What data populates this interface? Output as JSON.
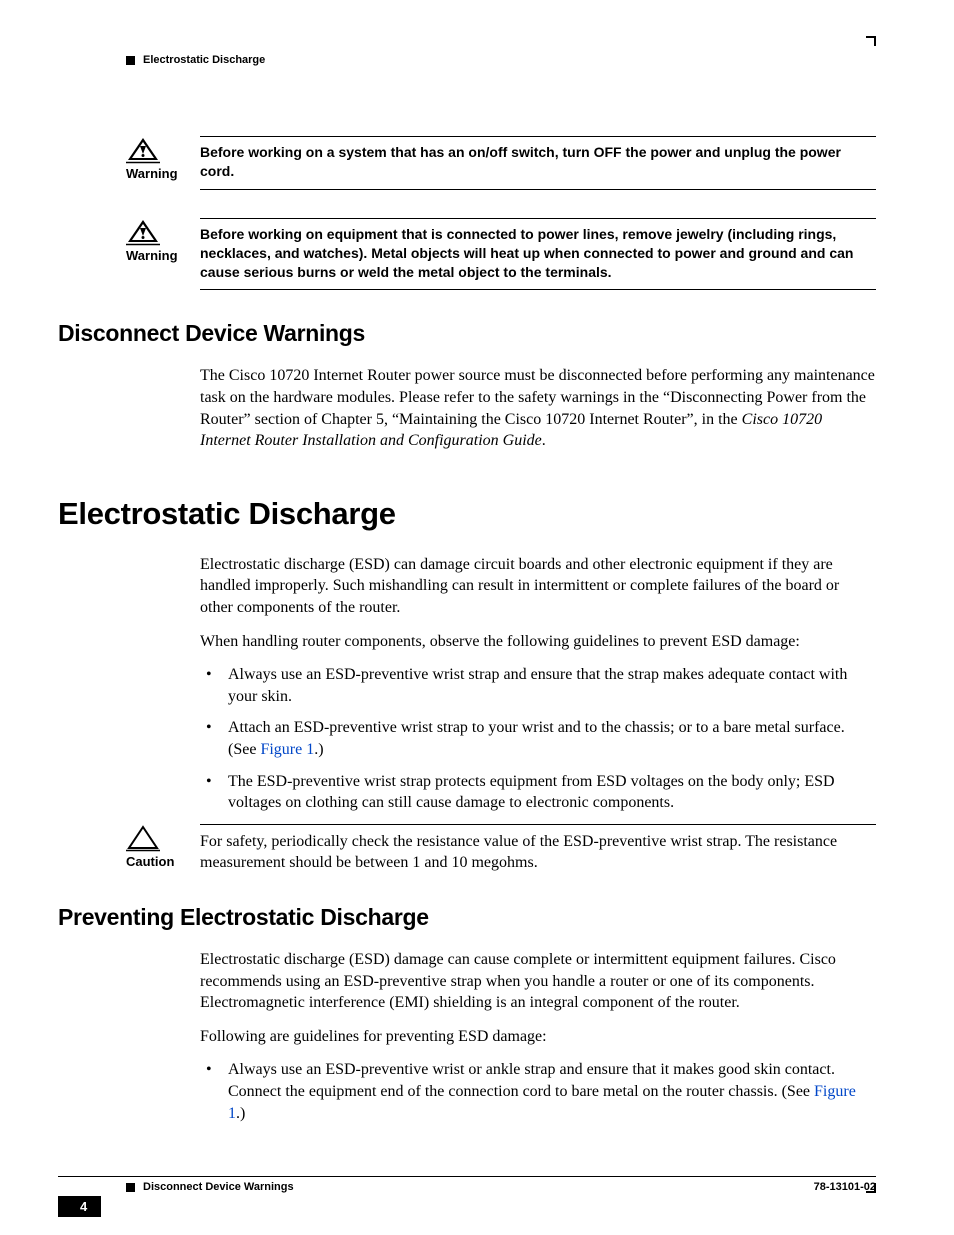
{
  "running_head": "Electrostatic Discharge",
  "warnings": [
    {
      "label": "Warning",
      "text": "Before working on a system that has an on/off switch, turn OFF the power and unplug the power cord."
    },
    {
      "label": "Warning",
      "text": "Before working on equipment that is connected to power lines, remove jewelry (including rings, necklaces, and watches). Metal objects will heat up when connected to power and ground and can cause serious burns or weld the metal object to the terminals."
    }
  ],
  "h2_disconnect": "Disconnect Device Warnings",
  "disconnect_p1_a": "The Cisco 10720 Internet Router power source must be disconnected before performing any maintenance task on the hardware modules. Please refer to the safety warnings in the “Disconnecting Power from the Router” section of Chapter 5, “Maintaining the Cisco 10720 Internet Router”, in the ",
  "disconnect_p1_italic": "Cisco 10720 Internet Router Installation and Configuration Guide",
  "disconnect_p1_b": ".",
  "h1_esd": "Electrostatic Discharge",
  "esd_p1": "Electrostatic discharge (ESD) can damage circuit boards and other electronic equipment if they are handled improperly. Such mishandling can result in intermittent or complete failures of the board or other components of the router.",
  "esd_p2": "When handling router components, observe the following guidelines to prevent ESD damage:",
  "esd_bullets": {
    "b1": "Always use an ESD-preventive wrist strap and ensure that the strap makes adequate contact with your skin.",
    "b2_a": "Attach an ESD-preventive wrist strap to your wrist and to the chassis; or to a bare metal surface. (See ",
    "b2_link": "Figure 1",
    "b2_b": ".)",
    "b3": "The ESD-preventive wrist strap protects equipment from ESD voltages on the body only; ESD voltages on clothing can still cause damage to electronic components."
  },
  "caution": {
    "label": "Caution",
    "text": "For safety, periodically check the resistance value of the ESD-preventive wrist strap. The resistance measurement should be between 1 and 10 megohms."
  },
  "h2_prevent": "Preventing Electrostatic Discharge",
  "prevent_p1": "Electrostatic discharge (ESD) damage can cause complete or intermittent equipment failures. Cisco recommends using an ESD-preventive strap when you handle a router or one of its components. Electromagnetic interference (EMI) shielding is an integral component of the router.",
  "prevent_p2": "Following are guidelines for preventing ESD damage:",
  "prevent_bullets": {
    "b1_a": "Always use an ESD-preventive wrist or ankle strap and ensure that it makes good skin contact. Connect the equipment end of the connection cord to bare metal on the router chassis. (See ",
    "b1_link": "Figure 1",
    "b1_b": ".)"
  },
  "footer": {
    "title": "Disconnect Device Warnings",
    "docnum": "78-13101-02",
    "pagenum": "4"
  }
}
